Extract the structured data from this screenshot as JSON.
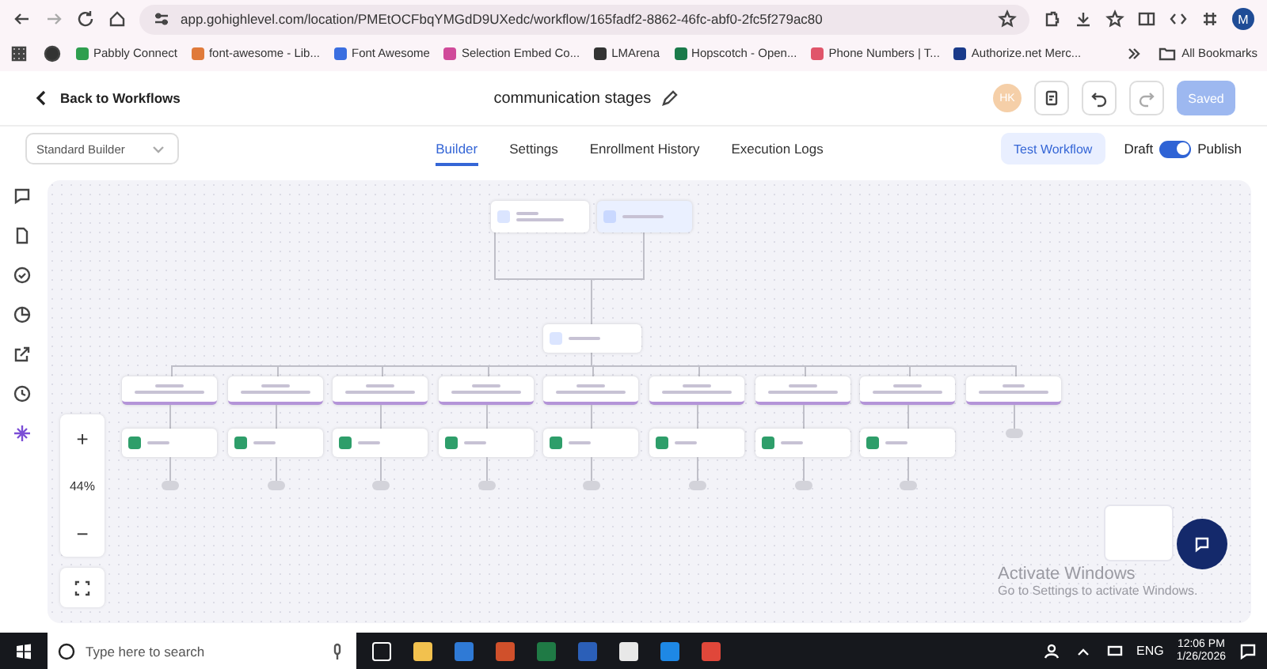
{
  "browser": {
    "url": "app.gohighlevel.com/location/PMEtOCFbqYMGdD9UXedc/workflow/165fadf2-8862-46fc-abf0-2fc5f279ac80",
    "profile": "M",
    "bookmarks": [
      {
        "label": "Pabbly Connect",
        "color": "#2e9e4f"
      },
      {
        "label": "font-awesome - Lib...",
        "color": "#e07a3a"
      },
      {
        "label": "Font Awesome",
        "color": "#3a6ee0"
      },
      {
        "label": "Selection Embed Co...",
        "color": "#d04a9a"
      },
      {
        "label": "LMArena",
        "color": "#333333"
      },
      {
        "label": "Hopscotch - Open...",
        "color": "#1a7a4a"
      },
      {
        "label": "Phone Numbers | T...",
        "color": "#e0556a"
      },
      {
        "label": "Authorize.net Merc...",
        "color": "#1a3a8a"
      }
    ],
    "all_bookmarks": "All Bookmarks"
  },
  "header": {
    "back": "Back to Workflows",
    "title": "communication stages",
    "avatar": "HK",
    "save_button": "Saved"
  },
  "toolbar": {
    "builder_select": "Standard Builder",
    "tabs": [
      {
        "label": "Builder",
        "selected": true
      },
      {
        "label": "Settings",
        "selected": false
      },
      {
        "label": "Enrollment History",
        "selected": false
      },
      {
        "label": "Execution Logs",
        "selected": false
      }
    ],
    "test_button": "Test Workflow",
    "draft_label": "Draft",
    "publish_on": true,
    "publish_label": "Publish"
  },
  "canvas": {
    "zoom_in": "+",
    "zoom_level": "44%",
    "zoom_out": "−",
    "branches": [
      {
        "kind": "branch"
      },
      {
        "kind": "branch"
      },
      {
        "kind": "branch"
      },
      {
        "kind": "branch"
      },
      {
        "kind": "branch"
      },
      {
        "kind": "branch"
      },
      {
        "kind": "branch"
      },
      {
        "kind": "branch"
      },
      {
        "kind": "else"
      }
    ]
  },
  "os_notice": {
    "title": "Activate Windows",
    "subtitle": "Go to Settings to activate Windows."
  },
  "taskbar": {
    "search_placeholder": "Type here to search",
    "language": "ENG",
    "time": "12:06 PM",
    "date": "1/26/2026"
  }
}
